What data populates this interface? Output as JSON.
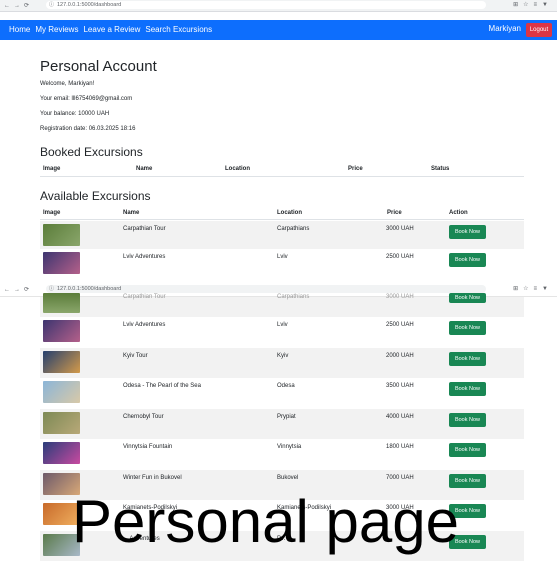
{
  "browser": {
    "url1": "127.0.0.1:5000/dashboard",
    "url2": "127.0.0.1:5000/dashboard"
  },
  "navbar": {
    "links": [
      "Home",
      "My Reviews",
      "Leave a Review",
      "Search Excursions"
    ],
    "user": "Markiyan",
    "logout": "Logout"
  },
  "account": {
    "title": "Personal Account",
    "welcome": "Welcome, Markiyan!",
    "email": "Your email: lll6754069@gmail.com",
    "balance": "Your balance: 10000 UAH",
    "registration": "Registration date: 06.03.2025 18:16"
  },
  "booked": {
    "title": "Booked Excursions",
    "headers": [
      "Image",
      "Name",
      "Location",
      "Price",
      "Status"
    ]
  },
  "available": {
    "title": "Available Excursions",
    "headers": [
      "Image",
      "Name",
      "Location",
      "Price",
      "Action"
    ],
    "book_label": "Book Now",
    "rows_top": [
      {
        "name": "Carpathian Tour",
        "location": "Carpathians",
        "price": "3000 UAH",
        "thumb_colors": [
          "#5b7d3a",
          "#8aa66b"
        ]
      },
      {
        "name": "Lviv Adventures",
        "location": "Lviv",
        "price": "2500 UAH",
        "thumb_colors": [
          "#3d3570",
          "#b4608a"
        ]
      }
    ],
    "rows_bottom": [
      {
        "name": "Lviv Adventures",
        "location": "Lviv",
        "price": "2500 UAH",
        "thumb_colors": [
          "#3d3570",
          "#b4608a"
        ]
      },
      {
        "name": "Kyiv Tour",
        "location": "Kyiv",
        "price": "2000 UAH",
        "thumb_colors": [
          "#25406e",
          "#d39a4a"
        ]
      },
      {
        "name": "Odesa - The Pearl of the Sea",
        "location": "Odesa",
        "price": "3500 UAH",
        "thumb_colors": [
          "#8bb5d8",
          "#d8c9a8"
        ]
      },
      {
        "name": "Chernobyl Tour",
        "location": "Prypiat",
        "price": "4000 UAH",
        "thumb_colors": [
          "#7d8a55",
          "#b8a878"
        ]
      },
      {
        "name": "Vinnytsia Fountain",
        "location": "Vinnytsia",
        "price": "1800 UAH",
        "thumb_colors": [
          "#2a3d7a",
          "#c84aa0"
        ]
      },
      {
        "name": "Winter Fun in Bukovel",
        "location": "Bukovel",
        "price": "7000 UAH",
        "thumb_colors": [
          "#6d5a6a",
          "#d8a878"
        ]
      },
      {
        "name": "Kamianets-Podilskyi",
        "location": "Kamianets-Podilskyi",
        "price": "3000 UAH",
        "thumb_colors": [
          "#c86a2a",
          "#f0b060"
        ]
      },
      {
        "name": "... Adventures",
        "location": "P...",
        "price": "",
        "thumb_colors": [
          "#5a7a4a",
          "#a8b8c8"
        ]
      }
    ],
    "cut_row": {
      "name": "Carpathian Tour",
      "location": "Carpathians",
      "price": "3000 UAH"
    }
  },
  "overlay_text": "Personal page",
  "colors": {
    "navbar": "#0d6efd",
    "logout": "#dc3545",
    "book_button": "#198754",
    "stripe": "#f2f2f2"
  }
}
